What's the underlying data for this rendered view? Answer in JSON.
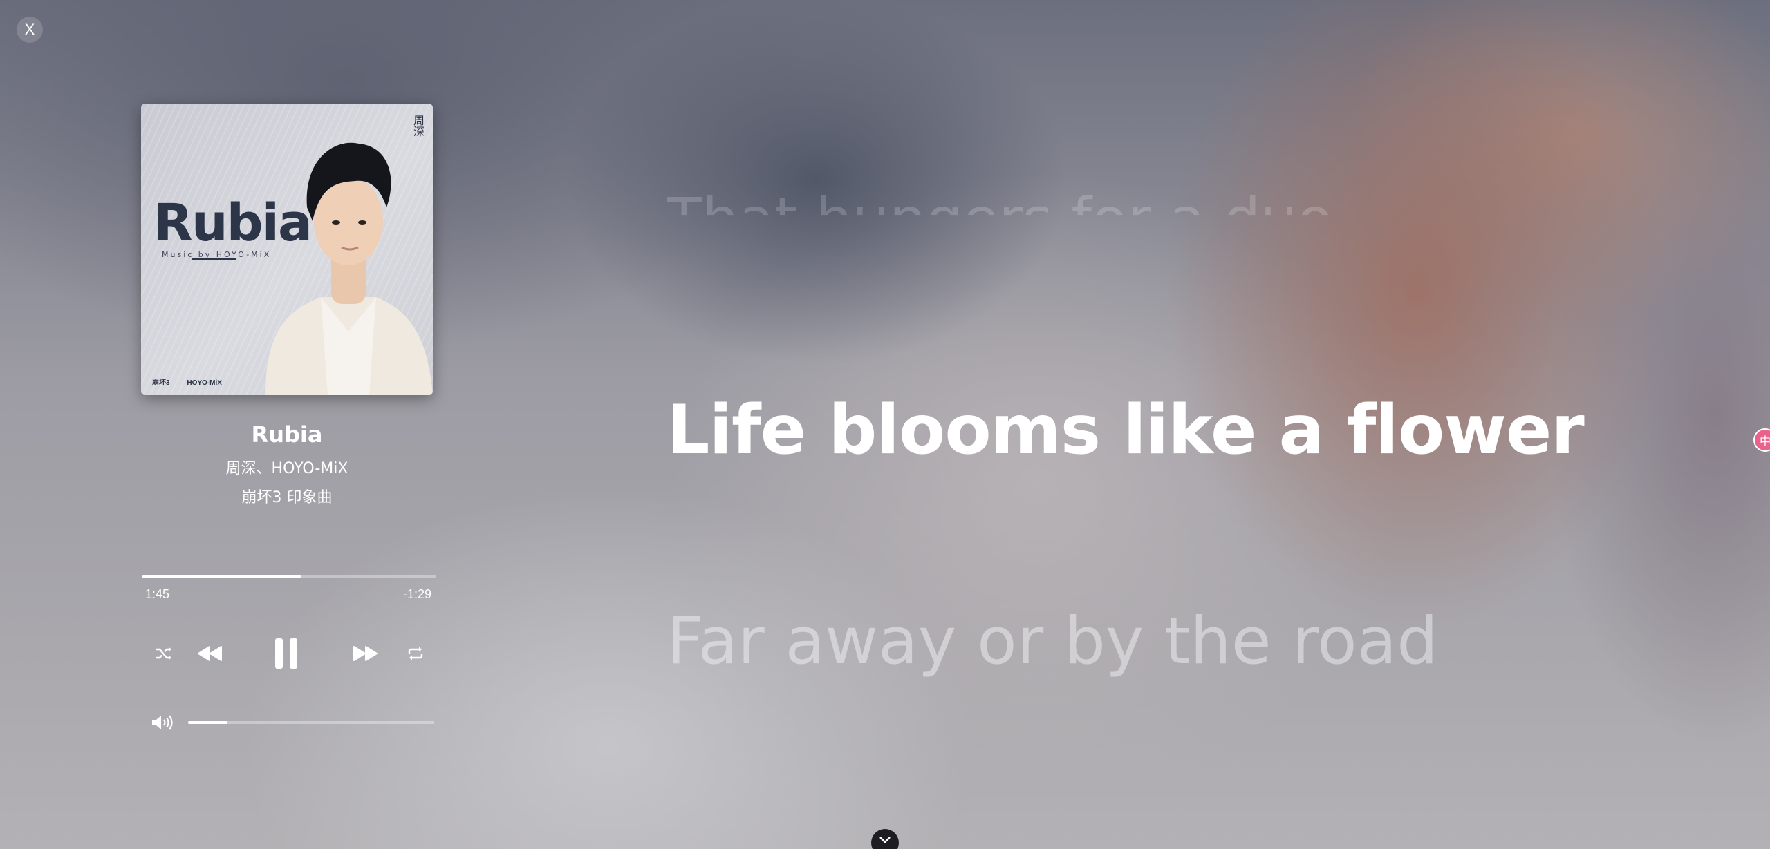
{
  "window": {
    "close_label": "X"
  },
  "album": {
    "cover_title": "Rubia",
    "cover_subtitle": "Music by HOYO-MiX",
    "cover_cjk": "周深",
    "cover_logo_left": "崩坏3",
    "cover_logo_right": "HOYO-MiX"
  },
  "song": {
    "title": "Rubia",
    "artists": "周深、HOYO-MiX",
    "album": "崩坏3 印象曲"
  },
  "playback": {
    "elapsed": "1:45",
    "remaining": "-1:29",
    "progress_fraction": 0.54,
    "volume_fraction": 0.16,
    "state": "playing"
  },
  "controls": {
    "shuffle_icon": "shuffle-icon",
    "previous_icon": "rewind-icon",
    "pause_icon": "pause-icon",
    "next_icon": "fast-forward-icon",
    "repeat_icon": "repeat-icon",
    "volume_icon": "volume-icon"
  },
  "lyrics": {
    "previous": "That hungers for a duo",
    "current": "Life blooms like a flower",
    "next": "Far away or by the road"
  },
  "side": {
    "translate_label": "中"
  },
  "colors": {
    "text": "#ffffff",
    "translate_badge": "#e8628c",
    "collapse_button": "#1e1e22"
  }
}
